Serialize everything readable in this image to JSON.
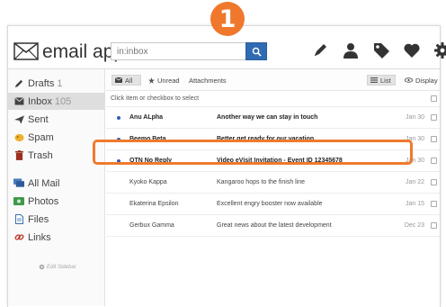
{
  "callout": {
    "number": "1"
  },
  "app": {
    "name": "email app"
  },
  "search": {
    "value": "",
    "placeholder": "in:inbox"
  },
  "header_tools": [
    "pen-icon",
    "user-icon",
    "tag-icon",
    "heart-icon",
    "gear-icon"
  ],
  "colors": {
    "accent": "#2f6bb3",
    "callout": "#f0782c",
    "unread_dot": "#2f5db8"
  },
  "sidebar": {
    "items": [
      {
        "label": "Drafts",
        "count": "1",
        "icon": "pencil-icon"
      },
      {
        "label": "Inbox",
        "count": "105",
        "icon": "inbox-icon"
      },
      {
        "label": "Sent",
        "count": "",
        "icon": "paper-plane-icon"
      },
      {
        "label": "Spam",
        "count": "",
        "icon": "spam-icon"
      },
      {
        "label": "Trash",
        "count": "",
        "icon": "trash-icon"
      },
      {
        "label": "All Mail",
        "count": "",
        "icon": "all-mail-icon"
      },
      {
        "label": "Photos",
        "count": "",
        "icon": "photo-icon"
      },
      {
        "label": "Files",
        "count": "",
        "icon": "file-icon"
      },
      {
        "label": "Links",
        "count": "",
        "icon": "link-icon"
      }
    ],
    "edit_label": "Edit Sidebar"
  },
  "toolbar": {
    "all_label": "All",
    "unread_label": "Unread",
    "attachments_label": "Attachments",
    "list_label": "List",
    "display_label": "Display"
  },
  "list": {
    "hint": "Click item or checkbox to select",
    "rows": [
      {
        "sender": "Anu ALpha",
        "subject": "Another way we can stay in touch",
        "date": "Jan 30",
        "unread": true
      },
      {
        "sender": "Beemo Beta",
        "subject": "Better get ready for our vacation",
        "date": "Jan 30",
        "unread": true
      },
      {
        "sender": "OTN No Reply",
        "subject": "Video eVisit Invitation - Event ID 12345678",
        "date": "Jan 30",
        "unread": true
      },
      {
        "sender": "Kyoko Kappa",
        "subject": "Kangaroo hops to the finish line",
        "date": "Jan 22",
        "unread": false
      },
      {
        "sender": "Ekaterina Epsilon",
        "subject": "Excellent engry booster now available",
        "date": "Jan 15",
        "unread": false
      },
      {
        "sender": "Gerbux Gamma",
        "subject": "Great news about the latest development",
        "date": "Dec 23",
        "unread": false
      }
    ]
  }
}
